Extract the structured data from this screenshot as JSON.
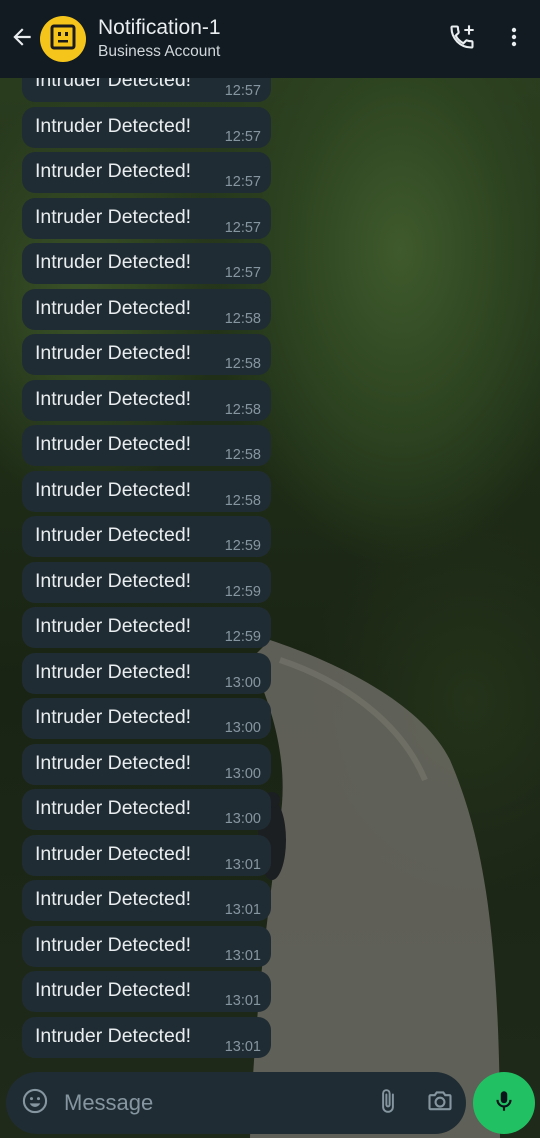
{
  "header": {
    "title": "Notification-1",
    "subtitle": "Business Account",
    "avatar_color": "#f6c51b"
  },
  "messages": [
    {
      "text": "Intruder Detected!",
      "time": "12:57"
    },
    {
      "text": "Intruder Detected!",
      "time": "12:57"
    },
    {
      "text": "Intruder Detected!",
      "time": "12:57"
    },
    {
      "text": "Intruder Detected!",
      "time": "12:57"
    },
    {
      "text": "Intruder Detected!",
      "time": "12:57"
    },
    {
      "text": "Intruder Detected!",
      "time": "12:58"
    },
    {
      "text": "Intruder Detected!",
      "time": "12:58"
    },
    {
      "text": "Intruder Detected!",
      "time": "12:58"
    },
    {
      "text": "Intruder Detected!",
      "time": "12:58"
    },
    {
      "text": "Intruder Detected!",
      "time": "12:58"
    },
    {
      "text": "Intruder Detected!",
      "time": "12:59"
    },
    {
      "text": "Intruder Detected!",
      "time": "12:59"
    },
    {
      "text": "Intruder Detected!",
      "time": "12:59"
    },
    {
      "text": "Intruder Detected!",
      "time": "13:00"
    },
    {
      "text": "Intruder Detected!",
      "time": "13:00"
    },
    {
      "text": "Intruder Detected!",
      "time": "13:00"
    },
    {
      "text": "Intruder Detected!",
      "time": "13:00"
    },
    {
      "text": "Intruder Detected!",
      "time": "13:01"
    },
    {
      "text": "Intruder Detected!",
      "time": "13:01"
    },
    {
      "text": "Intruder Detected!",
      "time": "13:01"
    },
    {
      "text": "Intruder Detected!",
      "time": "13:01"
    },
    {
      "text": "Intruder Detected!",
      "time": "13:01"
    }
  ],
  "composer": {
    "placeholder": "Message"
  },
  "icons": {
    "back": "back-arrow-icon",
    "add_call": "add-call-icon",
    "menu": "more-vertical-icon",
    "emoji": "emoji-icon",
    "attach": "paperclip-icon",
    "camera": "camera-icon",
    "mic": "microphone-icon"
  },
  "colors": {
    "header_bg": "#111b21",
    "bubble_bg": "#202c33",
    "mic_button": "#21c063"
  }
}
